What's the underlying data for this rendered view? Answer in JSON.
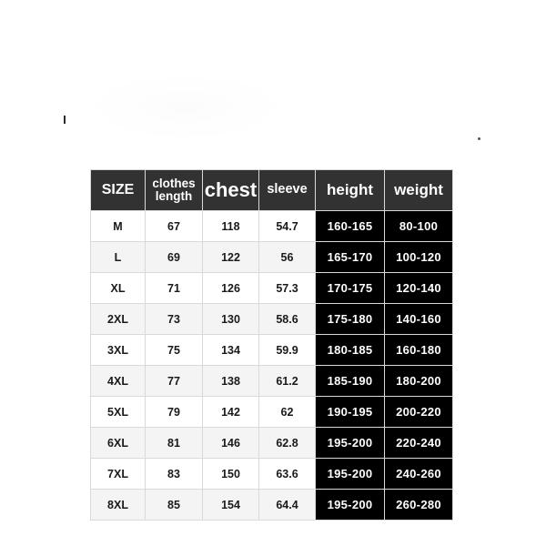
{
  "page": {
    "background_color": "#ffffff",
    "top_artifact_text": "· · ·   · · · · ·   · · ·   · ·"
  },
  "size_chart": {
    "name": "clothing-size-chart",
    "header_background": "#323232",
    "highlight_background": "#000000",
    "row_alt_background": "#f4f4f4",
    "columns": [
      {
        "key": "size",
        "label": "SIZE",
        "emphasis": "normal"
      },
      {
        "key": "clothes_length",
        "label_line1": "clothes",
        "label_line2": "length",
        "emphasis": "small"
      },
      {
        "key": "chest",
        "label": "chest",
        "emphasis": "large"
      },
      {
        "key": "sleeve",
        "label": "sleeve",
        "emphasis": "normal"
      },
      {
        "key": "height",
        "label": "height",
        "emphasis": "medium",
        "highlighted": true
      },
      {
        "key": "weight",
        "label": "weight",
        "emphasis": "medium",
        "highlighted": true
      }
    ],
    "rows": [
      {
        "size": "M",
        "clothes_length": "67",
        "chest": "118",
        "sleeve": "54.7",
        "height": "160-165",
        "weight": "80-100"
      },
      {
        "size": "L",
        "clothes_length": "69",
        "chest": "122",
        "sleeve": "56",
        "height": "165-170",
        "weight": "100-120"
      },
      {
        "size": "XL",
        "clothes_length": "71",
        "chest": "126",
        "sleeve": "57.3",
        "height": "170-175",
        "weight": "120-140"
      },
      {
        "size": "2XL",
        "clothes_length": "73",
        "chest": "130",
        "sleeve": "58.6",
        "height": "175-180",
        "weight": "140-160"
      },
      {
        "size": "3XL",
        "clothes_length": "75",
        "chest": "134",
        "sleeve": "59.9",
        "height": "180-185",
        "weight": "160-180"
      },
      {
        "size": "4XL",
        "clothes_length": "77",
        "chest": "138",
        "sleeve": "61.2",
        "height": "185-190",
        "weight": "180-200"
      },
      {
        "size": "5XL",
        "clothes_length": "79",
        "chest": "142",
        "sleeve": "62",
        "height": "190-195",
        "weight": "200-220"
      },
      {
        "size": "6XL",
        "clothes_length": "81",
        "chest": "146",
        "sleeve": "62.8",
        "height": "195-200",
        "weight": "220-240"
      },
      {
        "size": "7XL",
        "clothes_length": "83",
        "chest": "150",
        "sleeve": "63.6",
        "height": "195-200",
        "weight": "240-260"
      },
      {
        "size": "8XL",
        "clothes_length": "85",
        "chest": "154",
        "sleeve": "64.4",
        "height": "195-200",
        "weight": "260-280"
      }
    ]
  }
}
